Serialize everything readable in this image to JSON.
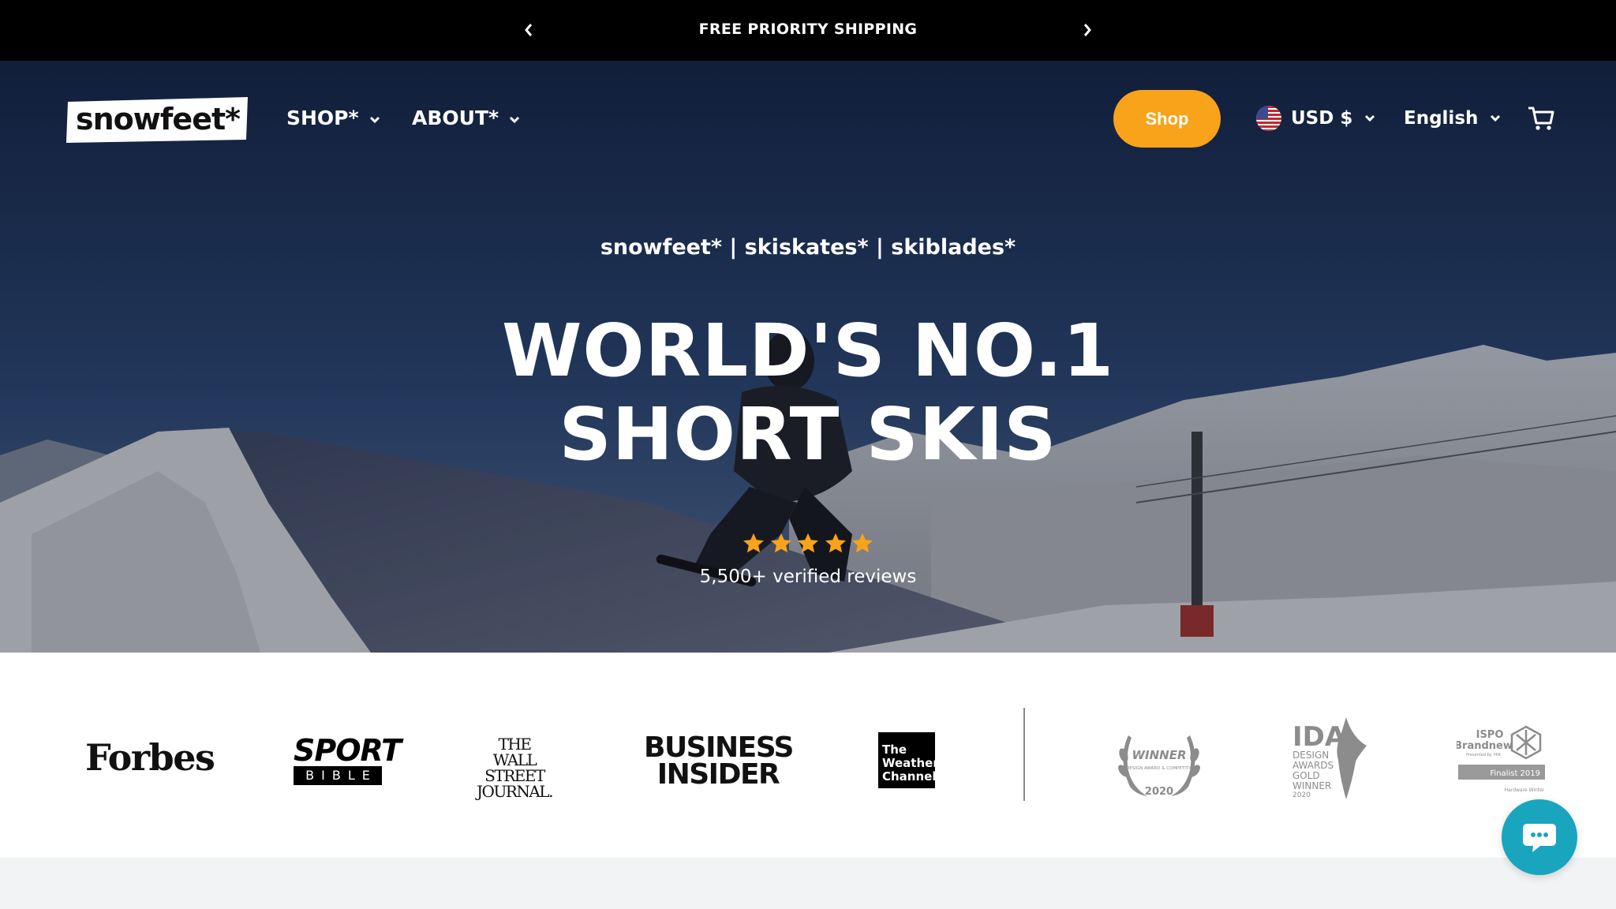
{
  "announcement": {
    "message": "FREE PRIORITY SHIPPING",
    "prev_icon": "chevron-left-icon",
    "next_icon": "chevron-right-icon"
  },
  "header": {
    "logo_text": "snowfeet*",
    "nav": [
      {
        "label": "SHOP*",
        "icon": "chevron-down-icon"
      },
      {
        "label": "ABOUT*",
        "icon": "chevron-down-icon"
      }
    ],
    "shop_button": "Shop",
    "currency": "USD $",
    "language": "English",
    "cart_icon": "cart-icon",
    "accent_color": "#f9a31a"
  },
  "hero": {
    "tagline": "snowfeet* | skiskates* | skiblades*",
    "headline_line1": "WORLD'S NO.1",
    "headline_line2": "SHORT SKIS",
    "rating_stars": 5,
    "reviews": "5,500+ verified reviews",
    "star_color": "#f9a31a"
  },
  "press": {
    "forbes": "Forbes",
    "sportbible_top": "SPORT",
    "sportbible_bottom": "BIBLE",
    "wsj_line1": "THE",
    "wsj_line2": "WALL STREET",
    "wsj_line3": "JOURNAL.",
    "bi_line1": "BUSINESS",
    "bi_line2": "INSIDER",
    "weather_line1": "The",
    "weather_line2": "Weather",
    "weather_line3": "Channel",
    "award1_title": "WINNER",
    "award1_sub": "A'DESIGN AWARD & COMPETITION",
    "award1_year": "2020",
    "award2_title": "IDA",
    "award2_lines": [
      "DESIGN",
      "AWARDS",
      "GOLD",
      "WINNER",
      "2020"
    ],
    "award3_title1": "ISPO",
    "award3_title2": "Brandnew",
    "award3_sub": "Presented by YKK",
    "award3_badge": "Finalist 2019",
    "award3_cat": "Hardware Winter"
  },
  "chat": {
    "icon": "chat-bubble-icon",
    "color": "#1aa5bf"
  }
}
